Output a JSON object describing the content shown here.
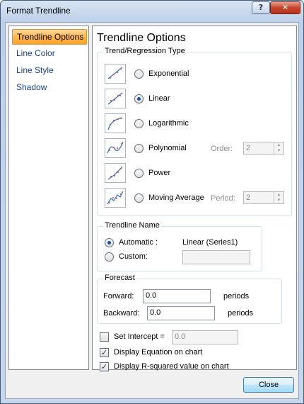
{
  "window": {
    "title": "Format Trendline",
    "help_label": "?",
    "close_glyph": "✕"
  },
  "sidebar": {
    "items": [
      {
        "label": "Trendline Options"
      },
      {
        "label": "Line Color"
      },
      {
        "label": "Line Style"
      },
      {
        "label": "Shadow"
      }
    ]
  },
  "pane": {
    "title": "Trendline Options",
    "trend_group": {
      "legend": "Trend/Regression Type",
      "options": [
        {
          "label": "Exponential",
          "selected": false
        },
        {
          "label": "Linear",
          "selected": true
        },
        {
          "label": "Logarithmic",
          "selected": false
        },
        {
          "label": "Polynomial",
          "selected": false
        },
        {
          "label": "Power",
          "selected": false
        },
        {
          "label": "Moving Average",
          "selected": false
        }
      ],
      "order_label": "Order:",
      "order_value": "2",
      "period_label": "Period:",
      "period_value": "2"
    },
    "name_group": {
      "legend": "Trendline Name",
      "automatic_label": "Automatic :",
      "automatic_value": "Linear (Series1)",
      "custom_label": "Custom:",
      "custom_value": ""
    },
    "forecast_group": {
      "legend": "Forecast",
      "forward_label": "Forward:",
      "forward_value": "0.0",
      "backward_label": "Backward:",
      "backward_value": "0.0",
      "periods_label": "periods"
    },
    "set_intercept": {
      "label": "Set Intercept =",
      "value": "0.0",
      "checked": false
    },
    "display_equation": {
      "label": "Display Equation on chart",
      "checked": true
    },
    "display_r_squared": {
      "label": "Display R-squared value on chart",
      "checked": true
    }
  },
  "footer": {
    "close_label": "Close"
  }
}
